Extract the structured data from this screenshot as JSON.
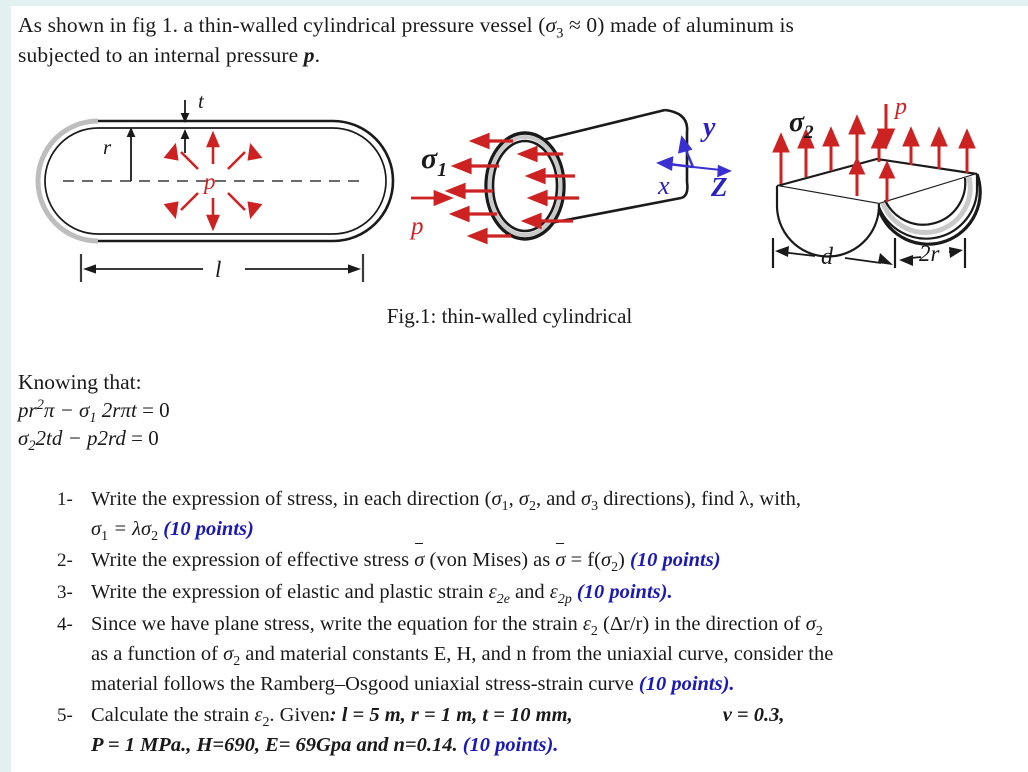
{
  "intro": {
    "line1_a": "As shown in fig 1. a thin-walled cylindrical pressure vessel (",
    "sigma3": "σ",
    "sigma3_sub": "3",
    "line1_b": " ≈ 0) made of aluminum is",
    "line2_a": "subjected to an internal pressure ",
    "line2_p": "p",
    "line2_b": "."
  },
  "figure": {
    "caption": "Fig.1: thin-walled cylindrical",
    "fig1": {
      "label_t": "t",
      "label_r": "r",
      "label_p": "p",
      "label_l": "l",
      "arrow_color": "#cc2222",
      "line_color": "#1a1a1a"
    },
    "fig2": {
      "label_sigma1": "σ",
      "label_sigma1_sub": "1",
      "label_p": "p",
      "axis_x": "x",
      "axis_y": "y",
      "axis_z": "Z",
      "arrow_color": "#cc2222",
      "axis_color": "#3a2fd0"
    },
    "fig3": {
      "label_sigma2": "σ",
      "label_sigma2_sub": "2",
      "label_p": "p",
      "label_d": "d",
      "label_2r": "2r",
      "arrow_color": "#cc2222"
    }
  },
  "knowing": {
    "heading": "Knowing that:",
    "eq1": "pr²π − σ₁2rπt = 0",
    "eq1_parts": {
      "a": "pr",
      "sup": "2",
      "b": "π − σ",
      "sub": "1",
      "c": " 2rπt",
      "eqz": " = 0"
    },
    "eq2_parts": {
      "a": "σ",
      "sub": "2",
      "b": "2td − p2rd",
      "eqz": " = 0"
    }
  },
  "questions": [
    {
      "num": "1-",
      "line1_a": "Write the expression of stress, in each direction (",
      "s1": "σ",
      "s1sub": "1",
      "mid1": ", ",
      "s2": "σ",
      "s2sub": "2",
      "mid2": ", and ",
      "s3": "σ",
      "s3sub": "3",
      "line1_b": " directions), find λ, with,",
      "line2_a": "σ",
      "line2_sub": "1",
      "line2_b": " = λσ",
      "line2_sub2": "2",
      "points": "(10 points)"
    },
    {
      "num": "2-",
      "text_a": "Write the expression of effective stress ",
      "sbar1": "σ",
      "text_b": " (von Mises) as ",
      "sbar2": "σ",
      "text_c": " = f(",
      "s2": "σ",
      "s2sub": "2",
      "text_d": ") ",
      "points": "(10 points)"
    },
    {
      "num": "3-",
      "text_a": "Write the expression of elastic and plastic strain  ",
      "e1": "ε",
      "e1sub": "2e",
      "text_b": " and ",
      "e2": "ε",
      "e2sub": "2p",
      "text_c": " ",
      "points": "(10 points)."
    },
    {
      "num": "4-",
      "line1_a": "Since we have plane stress, write the equation for the strain ",
      "e2": "ε",
      "e2sub": "2",
      "line1_b": " (Δr/r) in the direction of ",
      "s2": "σ",
      "s2sub": "2",
      "line2_a": "as a function of ",
      "line2_s2": "σ",
      "line2_s2sub": "2",
      "line2_b": " and material constants E, H, and n from the uniaxial curve, consider the",
      "line3_a": "material follows the Ramberg–Osgood uniaxial stress-strain curve ",
      "points": "(10 points)."
    },
    {
      "num": "5-",
      "line1_a": "Calculate the strain ",
      "e2": "ε",
      "e2sub": "2",
      "line1_b": ". Given",
      "line1_given": ": l = 5 m, r = 1 m, t = 10 mm,",
      "line1_nu": "v = 0.3,",
      "line2_a": "P = 1 MPa., H=690, E= 69Gpa and n=0.14. ",
      "points": "(10 points)."
    }
  ],
  "colors": {
    "points_blue": "#1a19b8",
    "arrow_red": "#cc2222",
    "axis_blue": "#3a2fd0",
    "page_edge": "#e2f0f2",
    "text": "#1a1a1a"
  }
}
